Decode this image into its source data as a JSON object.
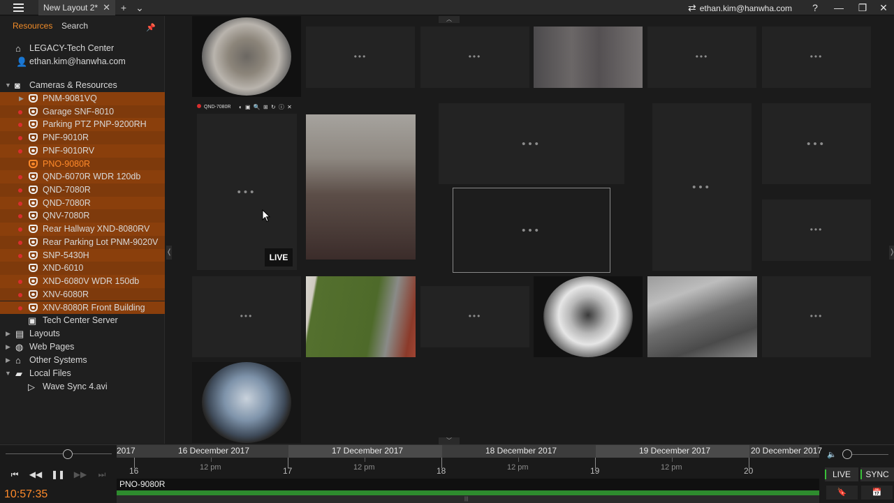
{
  "window": {
    "tab_title": "New Layout 2*",
    "tab_close": "✕",
    "new_tab": "+",
    "tab_menu": "⌄",
    "user_label": "ethan.kim@hanwha.com",
    "help": "?",
    "minimize": "—",
    "restore": "❐",
    "close": "✕"
  },
  "sidebar": {
    "tabs": [
      "Resources",
      "Search"
    ],
    "active_tab": "Resources",
    "system": "LEGACY-Tech Center",
    "user": "ethan.kim@hanwha.com",
    "cameras_header": "Cameras & Resources",
    "cameras": [
      {
        "label": "PNM-9081VQ",
        "recording": false,
        "selected": true,
        "expandable": true
      },
      {
        "label": "Garage SNF-8010",
        "recording": true,
        "selected": true
      },
      {
        "label": "Parking PTZ PNP-9200RH",
        "recording": true,
        "selected": true
      },
      {
        "label": "PNF-9010R",
        "recording": true,
        "selected": true
      },
      {
        "label": "PNF-9010RV",
        "recording": true,
        "selected": true
      },
      {
        "label": "PNO-9080R",
        "recording": false,
        "selected": true,
        "highlight": true
      },
      {
        "label": "QND-6070R WDR 120db",
        "recording": true,
        "selected": true
      },
      {
        "label": "QND-7080R",
        "recording": true,
        "selected": true
      },
      {
        "label": "QND-7080R",
        "recording": true,
        "selected": true
      },
      {
        "label": "QNV-7080R",
        "recording": true,
        "selected": true
      },
      {
        "label": "Rear Hallway XND-8080RV",
        "recording": true,
        "selected": true
      },
      {
        "label": "Rear Parking Lot PNM-9020V",
        "recording": true,
        "selected": true
      },
      {
        "label": "SNP-5430H",
        "recording": true,
        "selected": true
      },
      {
        "label": "XND-6010",
        "recording": false,
        "selected": true
      },
      {
        "label": "XND-6080V WDR 150db",
        "recording": true,
        "selected": true
      },
      {
        "label": "XNV-6080R",
        "recording": true,
        "selected": true
      },
      {
        "label": "XNV-8080R Front Building",
        "recording": true,
        "selected": true
      }
    ],
    "server": "Tech Center Server",
    "groups": [
      "Layouts",
      "Web Pages",
      "Other Systems"
    ],
    "local_files": "Local Files",
    "local_file_item": "Wave Sync 4.avi"
  },
  "viewer": {
    "active_tile_name": "QND-7080R",
    "active_tile_tools": "◐ ▣ 🔍 ⊞ ↻ ⓘ ✕",
    "live_badge": "LIVE"
  },
  "timeline": {
    "dates": [
      "2017",
      "16 December 2017",
      "17 December 2017",
      "18 December 2017",
      "19 December 2017",
      "20 December 2017"
    ],
    "days": [
      "16",
      "17",
      "18",
      "19",
      "20"
    ],
    "noon_label": "12 pm",
    "camera_track": "PNO-9080R",
    "clock": "10:57:35",
    "live_label": "LIVE",
    "sync_label": "SYNC",
    "controls": {
      "prev": "⏮",
      "rewind": "◀◀",
      "pause": "❚❚",
      "forward": "▶▶",
      "next": "⏭"
    }
  },
  "colors": {
    "accent": "#f28c28",
    "selection": "#8a3f0c",
    "recording": "#d82e2e",
    "live_green": "#39c139"
  }
}
